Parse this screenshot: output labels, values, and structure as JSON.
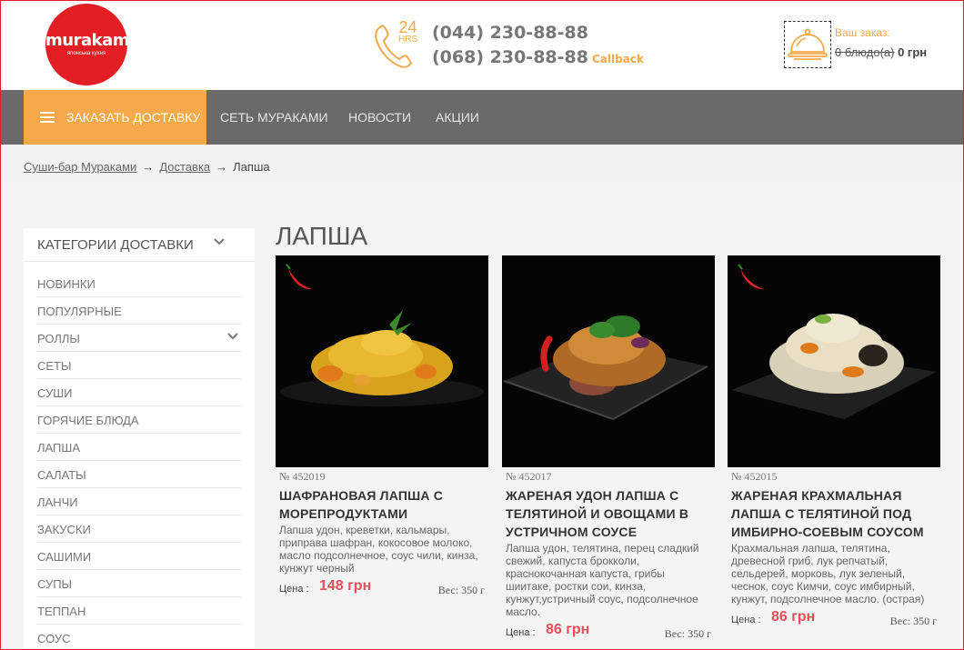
{
  "brand": {
    "logo_name": "murakami",
    "logo_tagline": "японська кухня"
  },
  "header": {
    "hours_number": "24",
    "hours_label": "HRS",
    "phone_1": "(044) 230-88-88",
    "phone_2": "(068) 230-88-88",
    "callback_label": "Callback",
    "cart_label": "Ваш заказ:",
    "cart_dishes": "0 блюдо(а)",
    "cart_total": "0 грн"
  },
  "nav": {
    "order_delivery": "ЗАКАЗАТЬ ДОСТАВКУ",
    "items": [
      "СЕТЬ МУРАКАМИ",
      "НОВОСТИ",
      "АКЦИИ"
    ]
  },
  "breadcrumb": {
    "items": [
      "Суши-бар Мураками",
      "Доставка"
    ],
    "current": "Лапша",
    "separator": "→"
  },
  "sidebar": {
    "title": "КАТЕГОРИИ ДОСТАВКИ",
    "categories": [
      "НОВИНКИ",
      "ПОПУЛЯРНЫЕ",
      "РОЛЛЫ",
      "СЕТЫ",
      "СУШИ",
      "ГОРЯЧИЕ БЛЮДА",
      "ЛАПША",
      "САЛАТЫ",
      "ЛАНЧИ",
      "ЗАКУСКИ",
      "САШИМИ",
      "СУПЫ",
      "ТЕППАН",
      "СОУС"
    ]
  },
  "page_title": "ЛАПША",
  "products": [
    {
      "sku": "№ 452019",
      "title": "ШАФРАНОВАЯ ЛАПША С МОРЕПРОДУКТАМИ",
      "description": "Лапша удон, креветки, кальмары, приправа шафран, кокосовое молоко, масло подсолнечное, соус чили, кинза, кунжут черный",
      "price_label": "Цена :",
      "price": "148 грн",
      "weight": "Вес: 350 г",
      "spicy": true
    },
    {
      "sku": "№ 452017",
      "title": "ЖАРЕНАЯ УДОН ЛАПША С ТЕЛЯТИНОЙ И ОВОЩАМИ В УСТРИЧНОМ СОУСЕ",
      "description": "Лапша удон, телятина, перец сладкий свежий, капуста брокколи, краснокочанная капуста, грибы шиитаке, ростки сои, кинза, кунжут,устричный соус, подсолнечное масло.",
      "price_label": "Цена :",
      "price": "86 грн",
      "weight": "Вес: 350 г",
      "spicy": false
    },
    {
      "sku": "№ 452015",
      "title": "ЖАРЕНАЯ КРАХМАЛЬНАЯ ЛАПША С ТЕЛЯТИНОЙ ПОД ИМБИРНО-СОЕВЫМ СОУСОМ",
      "description": "Крахмальная лапша, телятина, древесной гриб, лук репчатый, сельдерей, морковь, лук зеленый, чеснок, соус Кимчи, соус имбирный, кунжут, подсолнечное масло. (острая)",
      "price_label": "Цена :",
      "price": "86 грн",
      "weight": "Вес: 350 г",
      "spicy": true
    }
  ],
  "colors": {
    "accent": "#f6a94a",
    "brand_red": "#e31e24",
    "nav_bg": "#6a6a6a",
    "price": "#e8505b"
  }
}
